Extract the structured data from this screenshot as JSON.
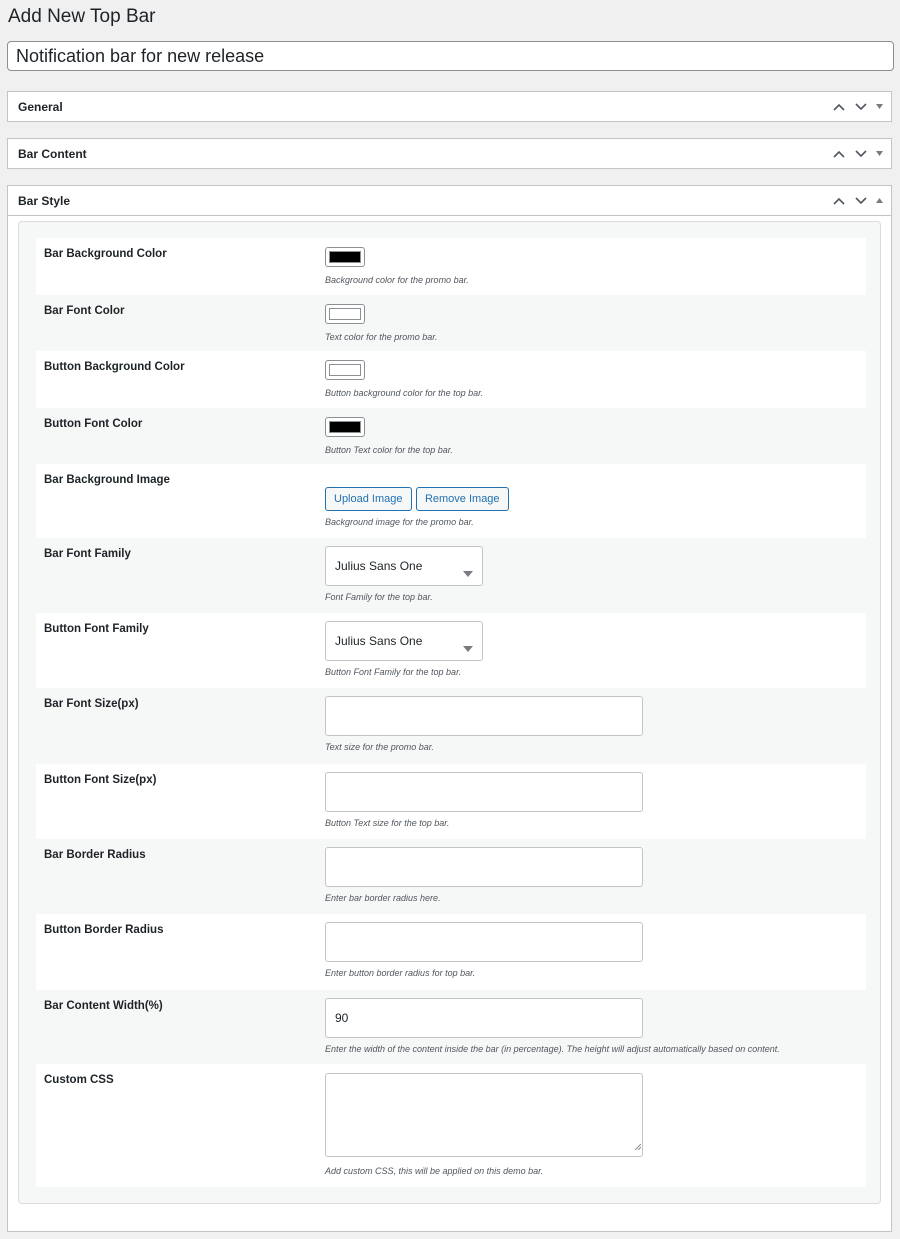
{
  "page": {
    "title": "Add New Top Bar"
  },
  "post_title": {
    "value": "Notification bar for new release"
  },
  "metaboxes": {
    "general": {
      "title": "General"
    },
    "bar_content": {
      "title": "Bar Content"
    },
    "bar_style": {
      "title": "Bar Style"
    }
  },
  "fields": {
    "bar_bg_color": {
      "label": "Bar Background Color",
      "value": "#000000",
      "description": "Background color for the promo bar."
    },
    "bar_font_color": {
      "label": "Bar Font Color",
      "value": "#ffffff",
      "description": "Text color for the promo bar."
    },
    "button_bg_color": {
      "label": "Button Background Color",
      "value": "#ffffff",
      "description": "Button background color for the top bar."
    },
    "button_font_color": {
      "label": "Button Font Color",
      "value": "#000000",
      "description": "Button Text color for the top bar."
    },
    "bar_bg_image": {
      "label": "Bar Background Image",
      "upload_label": "Upload Image",
      "remove_label": "Remove Image",
      "description": "Background image for the promo bar."
    },
    "bar_font_family": {
      "label": "Bar Font Family",
      "selected": "Julius Sans One",
      "description": "Font Family for the top bar."
    },
    "button_font_family": {
      "label": "Button Font Family",
      "selected": "Julius Sans One",
      "description": "Button Font Family for the top bar."
    },
    "bar_font_size": {
      "label": "Bar Font Size(px)",
      "value": "",
      "description": "Text size for the promo bar."
    },
    "button_font_size": {
      "label": "Button Font Size(px)",
      "value": "",
      "description": "Button Text size for the top bar."
    },
    "bar_border_radius": {
      "label": "Bar Border Radius",
      "value": "",
      "description": "Enter bar border radius here."
    },
    "button_border_radius": {
      "label": "Button Border Radius",
      "value": "",
      "description": "Enter button border radius for top bar."
    },
    "bar_content_width": {
      "label": "Bar Content Width(%)",
      "value": "90",
      "description": "Enter the width of the content inside the bar (in percentage). The height will adjust automatically based on content."
    },
    "custom_css": {
      "label": "Custom CSS",
      "value": "",
      "description": "Add custom CSS, this will be applied on this demo bar."
    }
  },
  "icons": {
    "move_up": "chevron-up-icon",
    "move_down": "chevron-down-icon",
    "toggle_collapsed": "triangle-down-icon",
    "toggle_expanded": "triangle-up-icon",
    "select_caret": "caret-down-icon"
  },
  "colors": {
    "accent": "#2271b1",
    "page_bg": "#f0f0f1",
    "border": "#c3c4c7"
  }
}
